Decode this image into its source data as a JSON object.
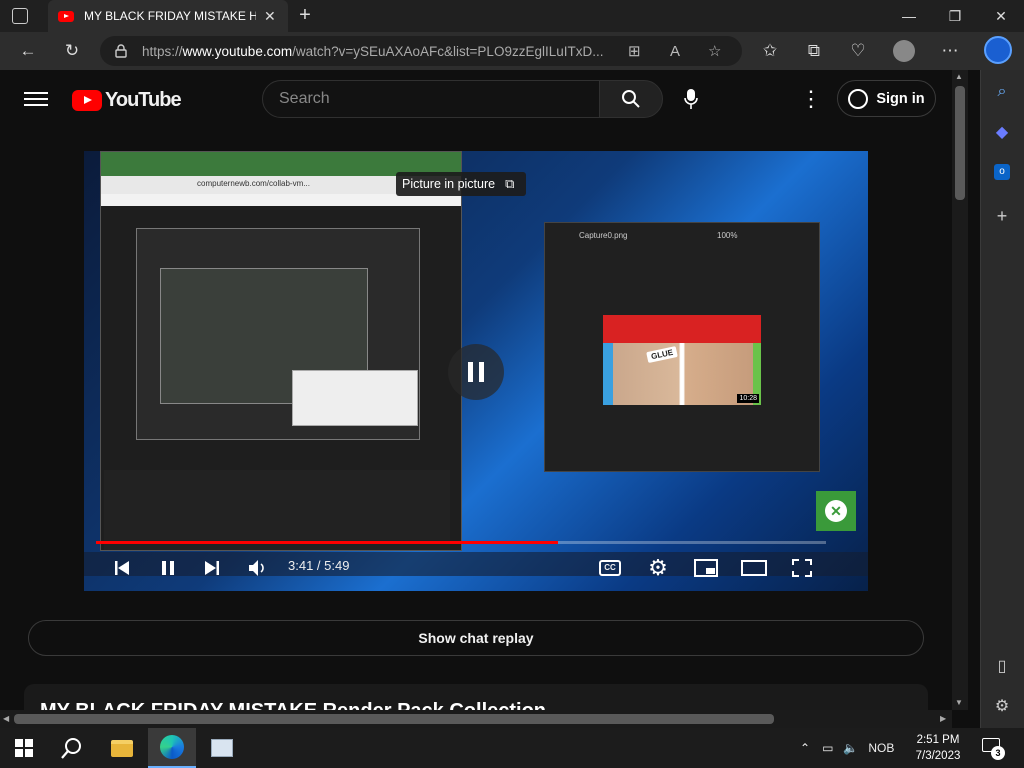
{
  "browser": {
    "tab_title": "MY BLACK FRIDAY MISTAKE Has",
    "url_prefix": "https://",
    "url_domain": "www.youtube.com",
    "url_rest": "/watch?v=ySEuAXAoAFc&list=PLO9zzEglILuITxD..."
  },
  "youtube": {
    "logo_text": "YouTube",
    "search_placeholder": "Search",
    "sign_in_label": "Sign in",
    "pip_tooltip": "Picture in picture",
    "current_time": "3:41",
    "duration": "5:49",
    "time_separator": " / ",
    "progress_fraction": 0.633,
    "chat_replay_label": "Show chat replay",
    "video_title": "MY BLACK FRIDAY MISTAKE Render Pack Collection"
  },
  "video_content": {
    "inner_browser_url": "computernewb.com/collab-vm...",
    "photo_window_title": "Capture0.png",
    "photo_zoom": "100%",
    "image_label": "GLUE",
    "image_duration": "10:28"
  },
  "taskbar": {
    "language": "NOB",
    "clock_time": "2:51 PM",
    "clock_date": "7/3/2023",
    "notification_count": "3"
  },
  "colors": {
    "yt_red": "#ff0000",
    "browser_dark": "#202020",
    "page_bg": "#0f0f0f"
  }
}
